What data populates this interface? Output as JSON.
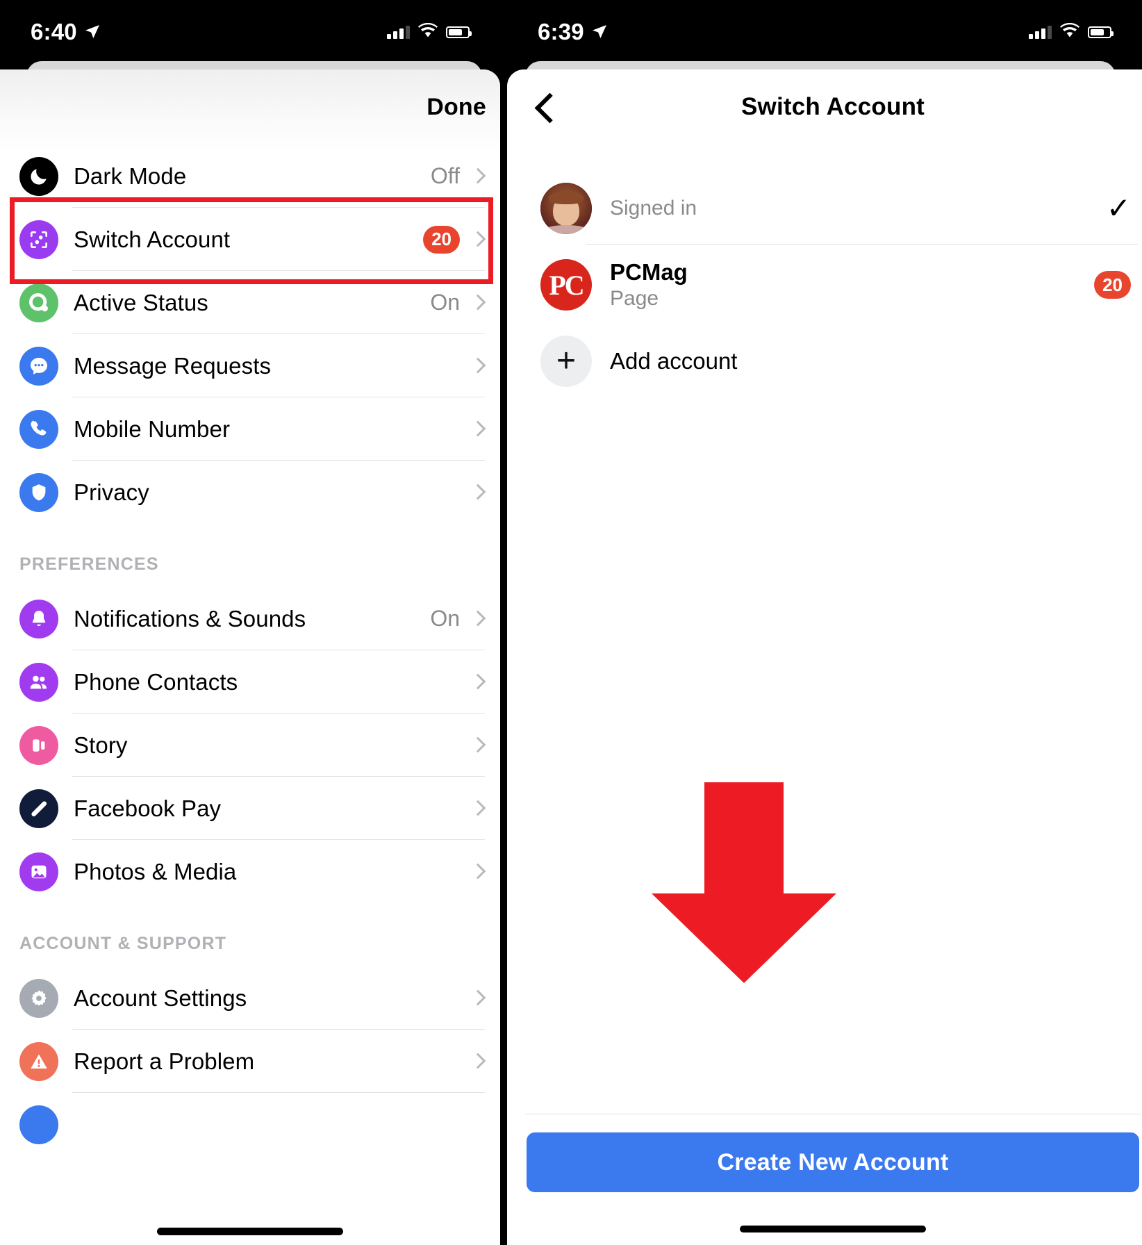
{
  "left_screen": {
    "status_bar": {
      "time": "6:40",
      "location_icon": "location-arrow-icon",
      "signal_icon": "cellular-bars-icon",
      "wifi_icon": "wifi-icon",
      "battery_icon": "battery-icon"
    },
    "nav": {
      "done_label": "Done"
    },
    "rows": [
      {
        "label": "Dark Mode",
        "value": "Off",
        "icon": "moon-icon",
        "color": "#000000",
        "badge": ""
      },
      {
        "label": "Switch Account",
        "value": "",
        "icon": "switch-account-icon",
        "color": "#9b3bf0",
        "badge": "20"
      },
      {
        "label": "Active Status",
        "value": "On",
        "icon": "active-status-icon",
        "color": "#5ec26a",
        "badge": ""
      },
      {
        "label": "Message Requests",
        "value": "",
        "icon": "chat-bubble-icon",
        "color": "#3b79ef",
        "badge": ""
      },
      {
        "label": "Mobile Number",
        "value": "",
        "icon": "phone-icon",
        "color": "#3b79ef",
        "badge": ""
      },
      {
        "label": "Privacy",
        "value": "",
        "icon": "shield-icon",
        "color": "#3b79ef",
        "badge": ""
      }
    ],
    "preferences_header": "PREFERENCES",
    "preference_rows": [
      {
        "label": "Notifications & Sounds",
        "value": "On",
        "icon": "bell-icon",
        "color": "#a13bf0",
        "badge": ""
      },
      {
        "label": "Phone Contacts",
        "value": "",
        "icon": "people-icon",
        "color": "#a13bf0",
        "badge": ""
      },
      {
        "label": "Story",
        "value": "",
        "icon": "story-icon",
        "color": "#ef5ba1",
        "badge": ""
      },
      {
        "label": "Facebook Pay",
        "value": "",
        "icon": "pay-icon",
        "color": "#111b3a",
        "badge": ""
      },
      {
        "label": "Photos & Media",
        "value": "",
        "icon": "photo-icon",
        "color": "#a13bf0",
        "badge": ""
      }
    ],
    "support_header": "ACCOUNT & SUPPORT",
    "support_rows": [
      {
        "label": "Account Settings",
        "value": "",
        "icon": "gear-icon",
        "color": "#a6aab3",
        "badge": ""
      },
      {
        "label": "Report a Problem",
        "value": "",
        "icon": "warning-icon",
        "color": "#ef7259",
        "badge": ""
      }
    ],
    "annotation": {
      "type": "red-rectangle",
      "target": "Switch Account",
      "color": "#ed1c24"
    }
  },
  "right_screen": {
    "status_bar": {
      "time": "6:39",
      "location_icon": "location-arrow-icon",
      "signal_icon": "cellular-bars-icon",
      "wifi_icon": "wifi-icon",
      "battery_icon": "battery-icon"
    },
    "nav": {
      "back_icon": "back-chevron-icon",
      "title": "Switch Account"
    },
    "accounts": [
      {
        "name": "",
        "subtitle": "Signed in",
        "avatar": "user-photo-avatar",
        "badge": "",
        "selected_icon": "checkmark-icon"
      },
      {
        "name": "PCMag",
        "subtitle": "Page",
        "avatar": "pcmag-logo",
        "badge": "20",
        "selected_icon": ""
      }
    ],
    "add_account": {
      "label": "Add account",
      "icon": "plus-icon"
    },
    "cta": {
      "label": "Create New Account",
      "color": "#3b79ef"
    },
    "annotation": {
      "type": "red-down-arrow",
      "target": "Create New Account",
      "color": "#ed1c24"
    }
  }
}
